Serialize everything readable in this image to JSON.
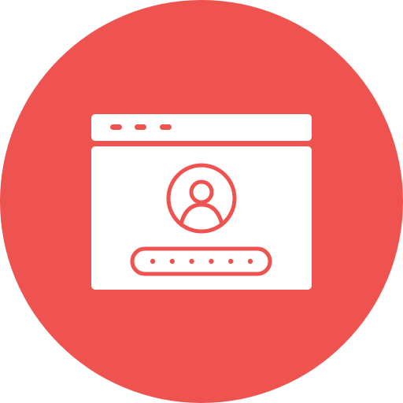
{
  "icon": {
    "name": "browser-login-icon",
    "parts": [
      "circle-background",
      "browser-window-icon",
      "window-control-dots",
      "user-avatar-icon",
      "password-field-icon"
    ],
    "password_mask_dots": 6
  },
  "colors": {
    "background_circle": "#EF5350",
    "foreground": "#FFFFFF",
    "detail": "#EF5350"
  }
}
